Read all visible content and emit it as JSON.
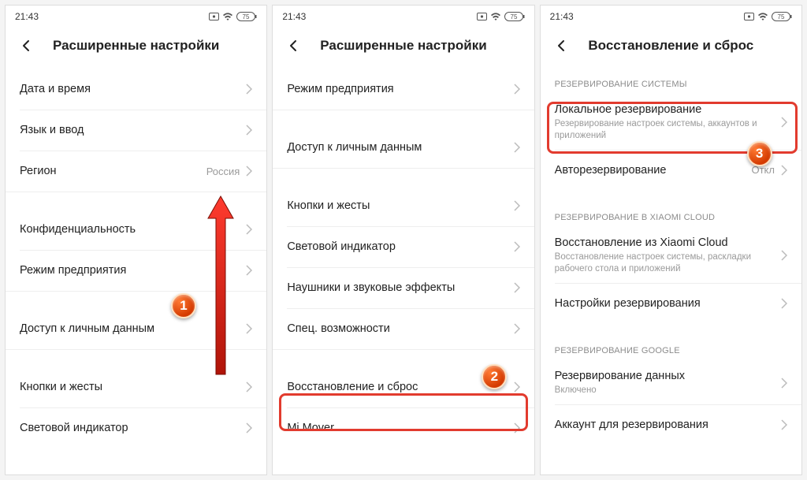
{
  "status": {
    "time": "21:43",
    "batteryText": "75"
  },
  "screen1": {
    "title": "Расширенные настройки",
    "items": [
      {
        "label": "Дата и время"
      },
      {
        "label": "Язык и ввод"
      },
      {
        "label": "Регион",
        "value": "Россия"
      },
      {
        "label": "Конфиденциальность"
      },
      {
        "label": "Режим предприятия"
      },
      {
        "label": "Доступ к личным данным"
      },
      {
        "label": "Кнопки и жесты"
      },
      {
        "label": "Световой индикатор"
      }
    ],
    "stepBadge": "1"
  },
  "screen2": {
    "title": "Расширенные настройки",
    "items": [
      {
        "label": "Режим предприятия"
      },
      {
        "label": "Доступ к личным данным"
      },
      {
        "label": "Кнопки и жесты"
      },
      {
        "label": "Световой индикатор"
      },
      {
        "label": "Наушники и звуковые эффекты"
      },
      {
        "label": "Спец. возможности"
      },
      {
        "label": "Восстановление и сброс"
      },
      {
        "label": "Mi Mover"
      }
    ],
    "stepBadge": "2"
  },
  "screen3": {
    "title": "Восстановление и сброс",
    "section1": "РЕЗЕРВИРОВАНИЕ СИСТЕМЫ",
    "localBackup": {
      "label": "Локальное резервирование",
      "sub": "Резервирование настроек системы, аккаунтов и приложений"
    },
    "autoBackup": {
      "label": "Авторезервирование",
      "value": "Откл"
    },
    "section2": "РЕЗЕРВИРОВАНИЕ В XIAOMI CLOUD",
    "cloudRestore": {
      "label": "Восстановление из Xiaomi Cloud",
      "sub": "Восстановление настроек системы, раскладки рабочего стола и приложений"
    },
    "backupSettings": {
      "label": "Настройки резервирования"
    },
    "section3": "РЕЗЕРВИРОВАНИЕ GOOGLE",
    "googleBackup": {
      "label": "Резервирование данных",
      "sub": "Включено"
    },
    "googleAccount": {
      "label": "Аккаунт для резервирования"
    },
    "stepBadge": "3"
  }
}
